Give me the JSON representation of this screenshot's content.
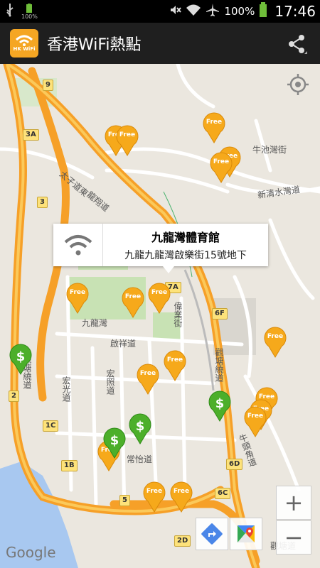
{
  "status_bar": {
    "time": "17:46",
    "battery_percent": "100%",
    "small_battery": "100%"
  },
  "app_bar": {
    "logo_text": "HK WiFi",
    "title": "香港WiFi熱點"
  },
  "map": {
    "road_labels": {
      "niuchi_wan": "牛池灣街",
      "xinqingshui_wan": "新清水灣道",
      "taizi_dao": "太子道東",
      "longxiang_dao": "龍翔道",
      "kowloon_bay": "九龍灣",
      "kaixiang_dao": "啟祥道",
      "tai_fu_kai": "偉業街",
      "kowloon_bay_rd": "觀塘繞道",
      "hong_kwong": "宏光道",
      "hong_chiu": "宏照道",
      "chiang_yi": "常怡道",
      "niuto_jiao": "牛頭角道",
      "bottom_road": "觀塘道",
      "kowloon_bay_right": "觀塘繞道"
    },
    "route_shields": {
      "s9": "9",
      "s3a": "3A",
      "s3": "3",
      "s7a": "7A",
      "s6f": "6F",
      "s2": "2",
      "s1c": "1C",
      "s1b": "1B",
      "s5": "5",
      "s6d": "6D",
      "s6c": "6C",
      "s2d": "2D"
    },
    "pin_text": "Free",
    "info_window": {
      "name": "九龍灣體育館",
      "address": "九龍九龍灣啟樂街15號地下"
    },
    "zoom_in": "+",
    "zoom_out": "−",
    "attribution": "Google"
  }
}
